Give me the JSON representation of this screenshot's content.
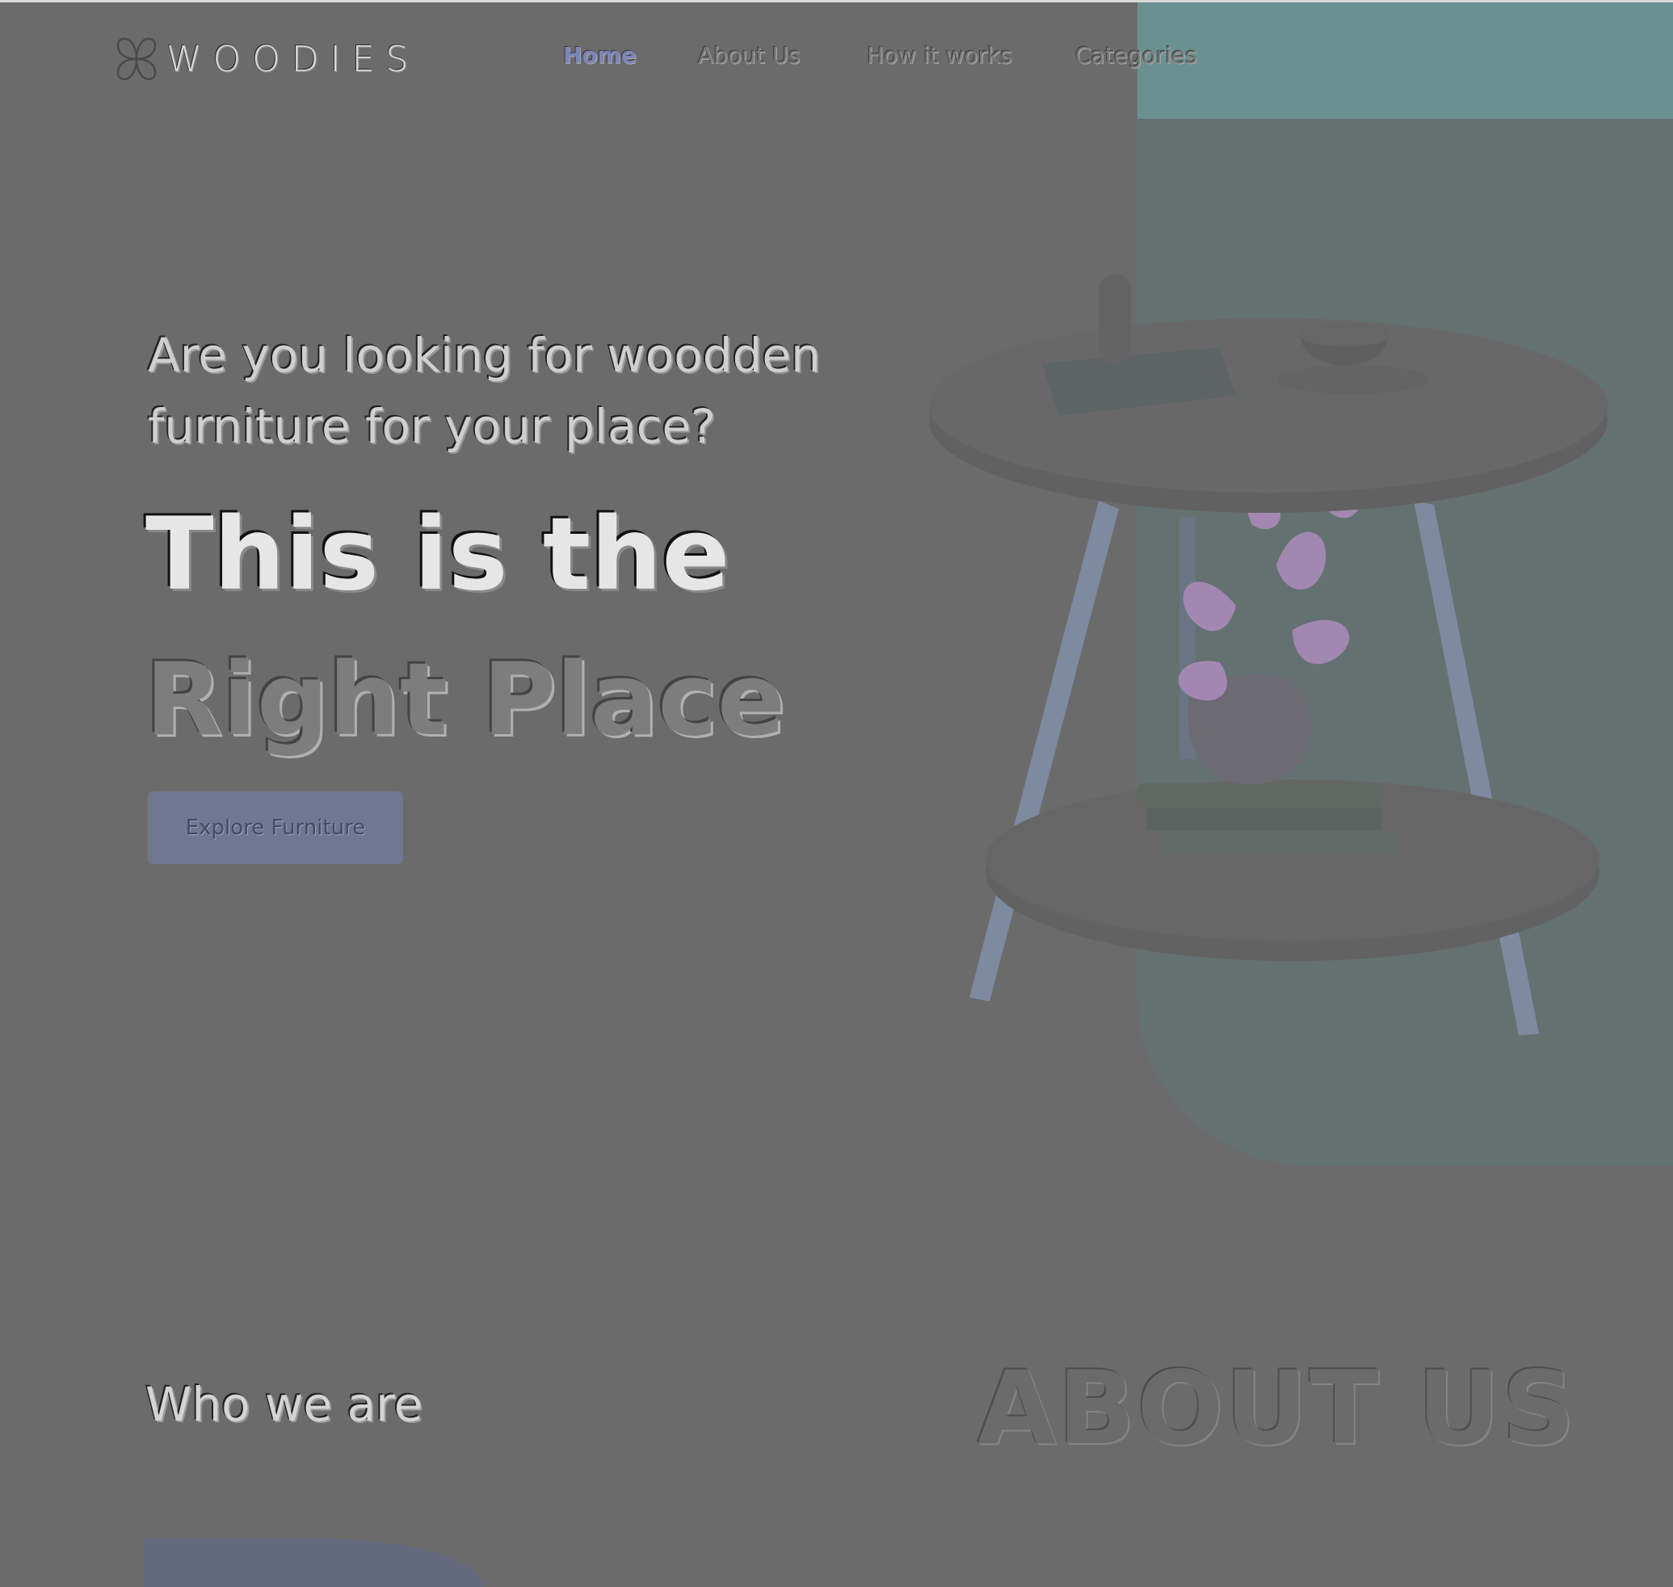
{
  "brand": {
    "name": "WOODIES",
    "logo_icon": "four-petal-logo-icon"
  },
  "nav": {
    "items": [
      {
        "label": "Home",
        "active": true
      },
      {
        "label": "About Us",
        "active": false
      },
      {
        "label": "How it works",
        "active": false
      },
      {
        "label": "Categories",
        "active": false
      }
    ]
  },
  "hero": {
    "question": "Are you looking for woodden furniture for your place?",
    "title_line1": "This is the",
    "title_line2": "Right Place",
    "cta_label": "Explore Furniture",
    "image": "side-table-with-plant-and-books"
  },
  "about": {
    "heading": "Who we are",
    "background_label": "ABOUT US"
  },
  "colors": {
    "page_bg": "#6b6b6b",
    "accent_teal": "#647171",
    "accent_blue": "#707891"
  }
}
